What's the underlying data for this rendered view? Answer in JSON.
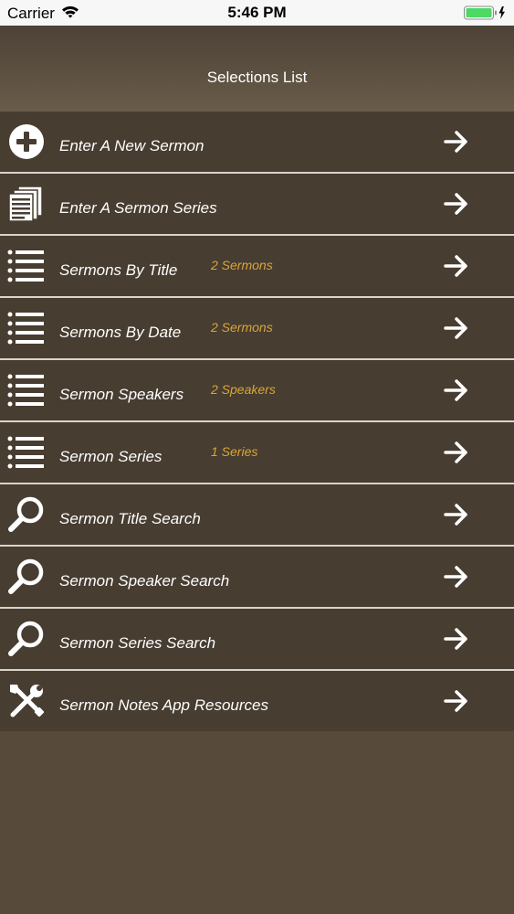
{
  "status_bar": {
    "carrier": "Carrier",
    "time": "5:46 PM",
    "battery_color": "#4cd964"
  },
  "nav": {
    "title": "Selections List"
  },
  "colors": {
    "background": "#574a3a",
    "row_background": "#473d31",
    "count_text": "#d9a63a",
    "divider": "#d9d4cc"
  },
  "rows": [
    {
      "label": "Enter A New Sermon",
      "count": "",
      "icon": "plus-circle-icon"
    },
    {
      "label": "Enter A Sermon Series",
      "count": "",
      "icon": "documents-icon"
    },
    {
      "label": "Sermons By Title",
      "count": "2 Sermons",
      "icon": "list-icon"
    },
    {
      "label": "Sermons By Date",
      "count": "2 Sermons",
      "icon": "list-icon"
    },
    {
      "label": "Sermon Speakers",
      "count": "2 Speakers",
      "icon": "list-icon"
    },
    {
      "label": "Sermon Series",
      "count": "1 Series",
      "icon": "list-icon"
    },
    {
      "label": "Sermon Title Search",
      "count": "",
      "icon": "magnifier-icon"
    },
    {
      "label": "Sermon Speaker Search",
      "count": "",
      "icon": "magnifier-icon"
    },
    {
      "label": "Sermon Series Search",
      "count": "",
      "icon": "magnifier-icon"
    },
    {
      "label": "Sermon Notes App Resources",
      "count": "",
      "icon": "tools-icon"
    }
  ]
}
